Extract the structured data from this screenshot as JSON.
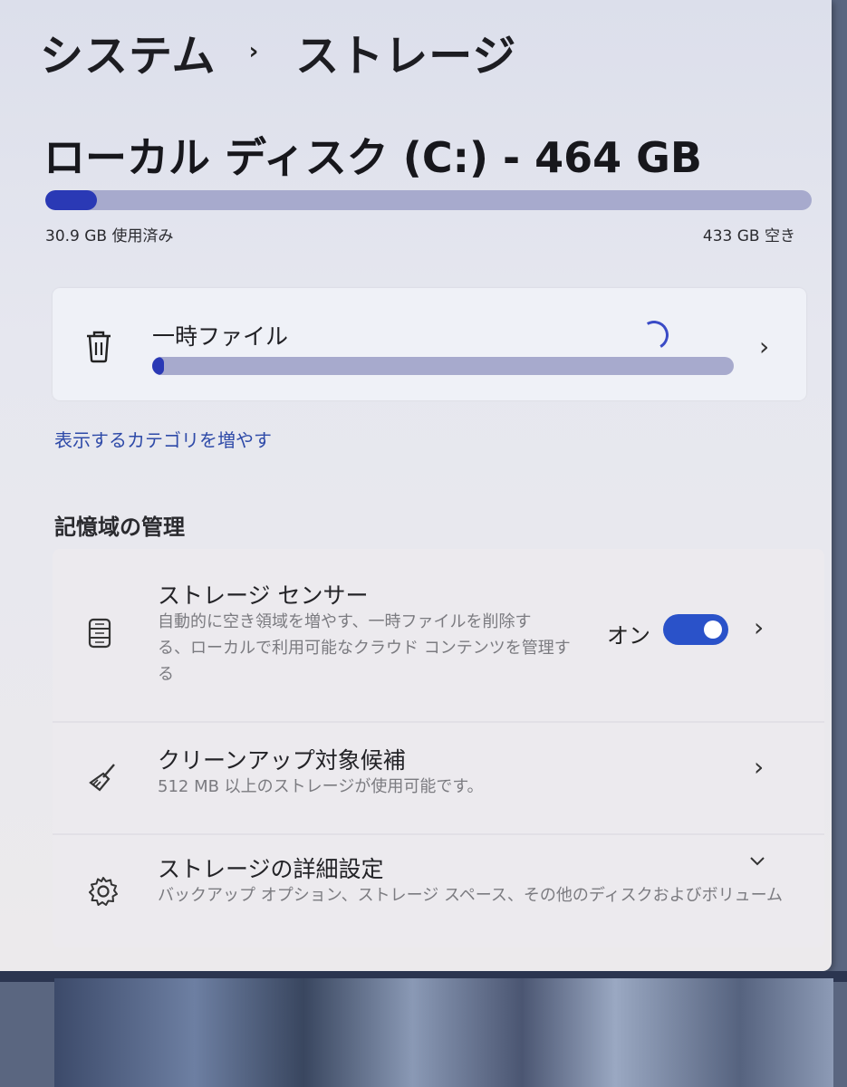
{
  "breadcrumb": {
    "parent": "システム",
    "separator": "›",
    "current": "ストレージ"
  },
  "disk": {
    "title": "ローカル ディスク (C:) - 464 GB",
    "used_label": "30.9 GB 使用済み",
    "free_label": "433 GB 空き",
    "used_fraction": 0.067
  },
  "temp_files": {
    "label": "一時ファイル",
    "progress_fraction": 0.02
  },
  "more_categories_link": "表示するカテゴリを増やす",
  "storage_management": {
    "title": "記憶域の管理",
    "storage_sense": {
      "title": "ストレージ センサー",
      "description_lines": [
        "自動的に空き領域を増やす、一時ファイルを削除す",
        "る、ローカルで利用可能なクラウド コンテンツを管理す",
        "る"
      ],
      "toggle_label": "オン",
      "toggle_on": true
    },
    "cleanup": {
      "title": "クリーンアップ対象候補",
      "description": "512 MB 以上のストレージが使用可能です。"
    },
    "advanced": {
      "title": "ストレージの詳細設定",
      "description": "バックアップ オプション、ストレージ スペース、その他のディスクおよびボリューム"
    }
  },
  "colors": {
    "accent": "#2a39b5",
    "toggle": "#2a52c9",
    "link": "#2e4aa8",
    "bar_track": "#a7aacd"
  },
  "icons": [
    "trash-icon",
    "chevron-right-icon",
    "loading-spinner-icon",
    "storage-drive-icon",
    "broom-icon",
    "gear-icon",
    "chevron-down-icon"
  ]
}
